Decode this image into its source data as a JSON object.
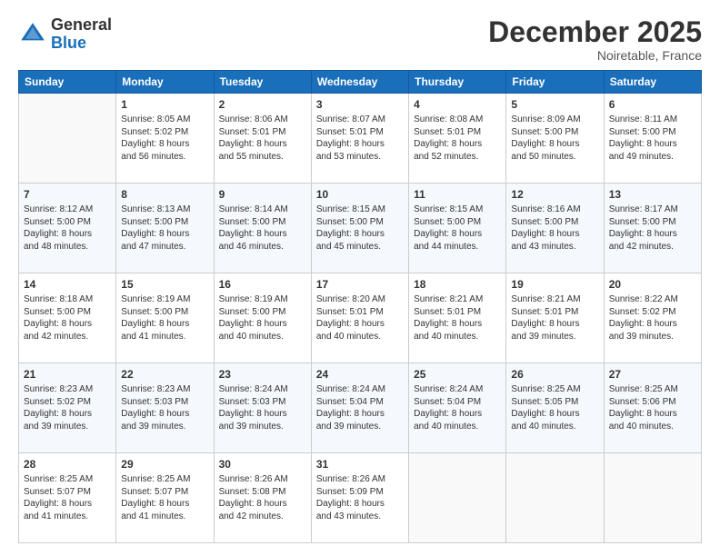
{
  "header": {
    "logo_general": "General",
    "logo_blue": "Blue",
    "month": "December 2025",
    "location": "Noiretable, France"
  },
  "weekdays": [
    "Sunday",
    "Monday",
    "Tuesday",
    "Wednesday",
    "Thursday",
    "Friday",
    "Saturday"
  ],
  "weeks": [
    [
      {
        "day": "",
        "info": ""
      },
      {
        "day": "1",
        "info": "Sunrise: 8:05 AM\nSunset: 5:02 PM\nDaylight: 8 hours\nand 56 minutes."
      },
      {
        "day": "2",
        "info": "Sunrise: 8:06 AM\nSunset: 5:01 PM\nDaylight: 8 hours\nand 55 minutes."
      },
      {
        "day": "3",
        "info": "Sunrise: 8:07 AM\nSunset: 5:01 PM\nDaylight: 8 hours\nand 53 minutes."
      },
      {
        "day": "4",
        "info": "Sunrise: 8:08 AM\nSunset: 5:01 PM\nDaylight: 8 hours\nand 52 minutes."
      },
      {
        "day": "5",
        "info": "Sunrise: 8:09 AM\nSunset: 5:00 PM\nDaylight: 8 hours\nand 50 minutes."
      },
      {
        "day": "6",
        "info": "Sunrise: 8:11 AM\nSunset: 5:00 PM\nDaylight: 8 hours\nand 49 minutes."
      }
    ],
    [
      {
        "day": "7",
        "info": "Sunrise: 8:12 AM\nSunset: 5:00 PM\nDaylight: 8 hours\nand 48 minutes."
      },
      {
        "day": "8",
        "info": "Sunrise: 8:13 AM\nSunset: 5:00 PM\nDaylight: 8 hours\nand 47 minutes."
      },
      {
        "day": "9",
        "info": "Sunrise: 8:14 AM\nSunset: 5:00 PM\nDaylight: 8 hours\nand 46 minutes."
      },
      {
        "day": "10",
        "info": "Sunrise: 8:15 AM\nSunset: 5:00 PM\nDaylight: 8 hours\nand 45 minutes."
      },
      {
        "day": "11",
        "info": "Sunrise: 8:15 AM\nSunset: 5:00 PM\nDaylight: 8 hours\nand 44 minutes."
      },
      {
        "day": "12",
        "info": "Sunrise: 8:16 AM\nSunset: 5:00 PM\nDaylight: 8 hours\nand 43 minutes."
      },
      {
        "day": "13",
        "info": "Sunrise: 8:17 AM\nSunset: 5:00 PM\nDaylight: 8 hours\nand 42 minutes."
      }
    ],
    [
      {
        "day": "14",
        "info": "Sunrise: 8:18 AM\nSunset: 5:00 PM\nDaylight: 8 hours\nand 42 minutes."
      },
      {
        "day": "15",
        "info": "Sunrise: 8:19 AM\nSunset: 5:00 PM\nDaylight: 8 hours\nand 41 minutes."
      },
      {
        "day": "16",
        "info": "Sunrise: 8:19 AM\nSunset: 5:00 PM\nDaylight: 8 hours\nand 40 minutes."
      },
      {
        "day": "17",
        "info": "Sunrise: 8:20 AM\nSunset: 5:01 PM\nDaylight: 8 hours\nand 40 minutes."
      },
      {
        "day": "18",
        "info": "Sunrise: 8:21 AM\nSunset: 5:01 PM\nDaylight: 8 hours\nand 40 minutes."
      },
      {
        "day": "19",
        "info": "Sunrise: 8:21 AM\nSunset: 5:01 PM\nDaylight: 8 hours\nand 39 minutes."
      },
      {
        "day": "20",
        "info": "Sunrise: 8:22 AM\nSunset: 5:02 PM\nDaylight: 8 hours\nand 39 minutes."
      }
    ],
    [
      {
        "day": "21",
        "info": "Sunrise: 8:23 AM\nSunset: 5:02 PM\nDaylight: 8 hours\nand 39 minutes."
      },
      {
        "day": "22",
        "info": "Sunrise: 8:23 AM\nSunset: 5:03 PM\nDaylight: 8 hours\nand 39 minutes."
      },
      {
        "day": "23",
        "info": "Sunrise: 8:24 AM\nSunset: 5:03 PM\nDaylight: 8 hours\nand 39 minutes."
      },
      {
        "day": "24",
        "info": "Sunrise: 8:24 AM\nSunset: 5:04 PM\nDaylight: 8 hours\nand 39 minutes."
      },
      {
        "day": "25",
        "info": "Sunrise: 8:24 AM\nSunset: 5:04 PM\nDaylight: 8 hours\nand 40 minutes."
      },
      {
        "day": "26",
        "info": "Sunrise: 8:25 AM\nSunset: 5:05 PM\nDaylight: 8 hours\nand 40 minutes."
      },
      {
        "day": "27",
        "info": "Sunrise: 8:25 AM\nSunset: 5:06 PM\nDaylight: 8 hours\nand 40 minutes."
      }
    ],
    [
      {
        "day": "28",
        "info": "Sunrise: 8:25 AM\nSunset: 5:07 PM\nDaylight: 8 hours\nand 41 minutes."
      },
      {
        "day": "29",
        "info": "Sunrise: 8:25 AM\nSunset: 5:07 PM\nDaylight: 8 hours\nand 41 minutes."
      },
      {
        "day": "30",
        "info": "Sunrise: 8:26 AM\nSunset: 5:08 PM\nDaylight: 8 hours\nand 42 minutes."
      },
      {
        "day": "31",
        "info": "Sunrise: 8:26 AM\nSunset: 5:09 PM\nDaylight: 8 hours\nand 43 minutes."
      },
      {
        "day": "",
        "info": ""
      },
      {
        "day": "",
        "info": ""
      },
      {
        "day": "",
        "info": ""
      }
    ]
  ]
}
